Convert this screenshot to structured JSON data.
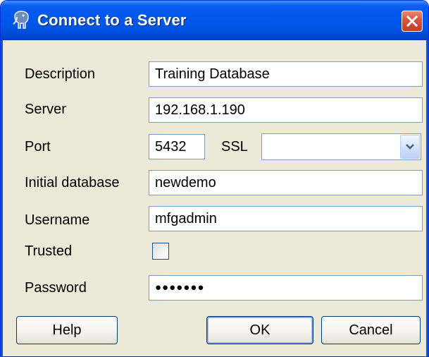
{
  "window": {
    "title": "Connect to a Server"
  },
  "form": {
    "description": {
      "label": "Description",
      "value": "Training Database"
    },
    "server": {
      "label": "Server",
      "value": "192.168.1.190"
    },
    "port": {
      "label": "Port",
      "value": "5432"
    },
    "ssl": {
      "label": "SSL",
      "value": ""
    },
    "initial_database": {
      "label": "Initial database",
      "value": "newdemo"
    },
    "username": {
      "label": "Username",
      "value": "mfgadmin"
    },
    "trusted": {
      "label": "Trusted",
      "checked": false
    },
    "password": {
      "label": "Password",
      "masked_value": "●●●●●●●"
    }
  },
  "buttons": {
    "help": "Help",
    "ok": "OK",
    "cancel": "Cancel"
  },
  "icons": {
    "app": "elephant-icon",
    "close": "close-icon",
    "dropdown": "chevron-down-icon"
  },
  "colors": {
    "titlebar": "#0054e3",
    "client_bg": "#ece9d8",
    "field_border": "#7f9db9",
    "close_button": "#d8533a"
  }
}
